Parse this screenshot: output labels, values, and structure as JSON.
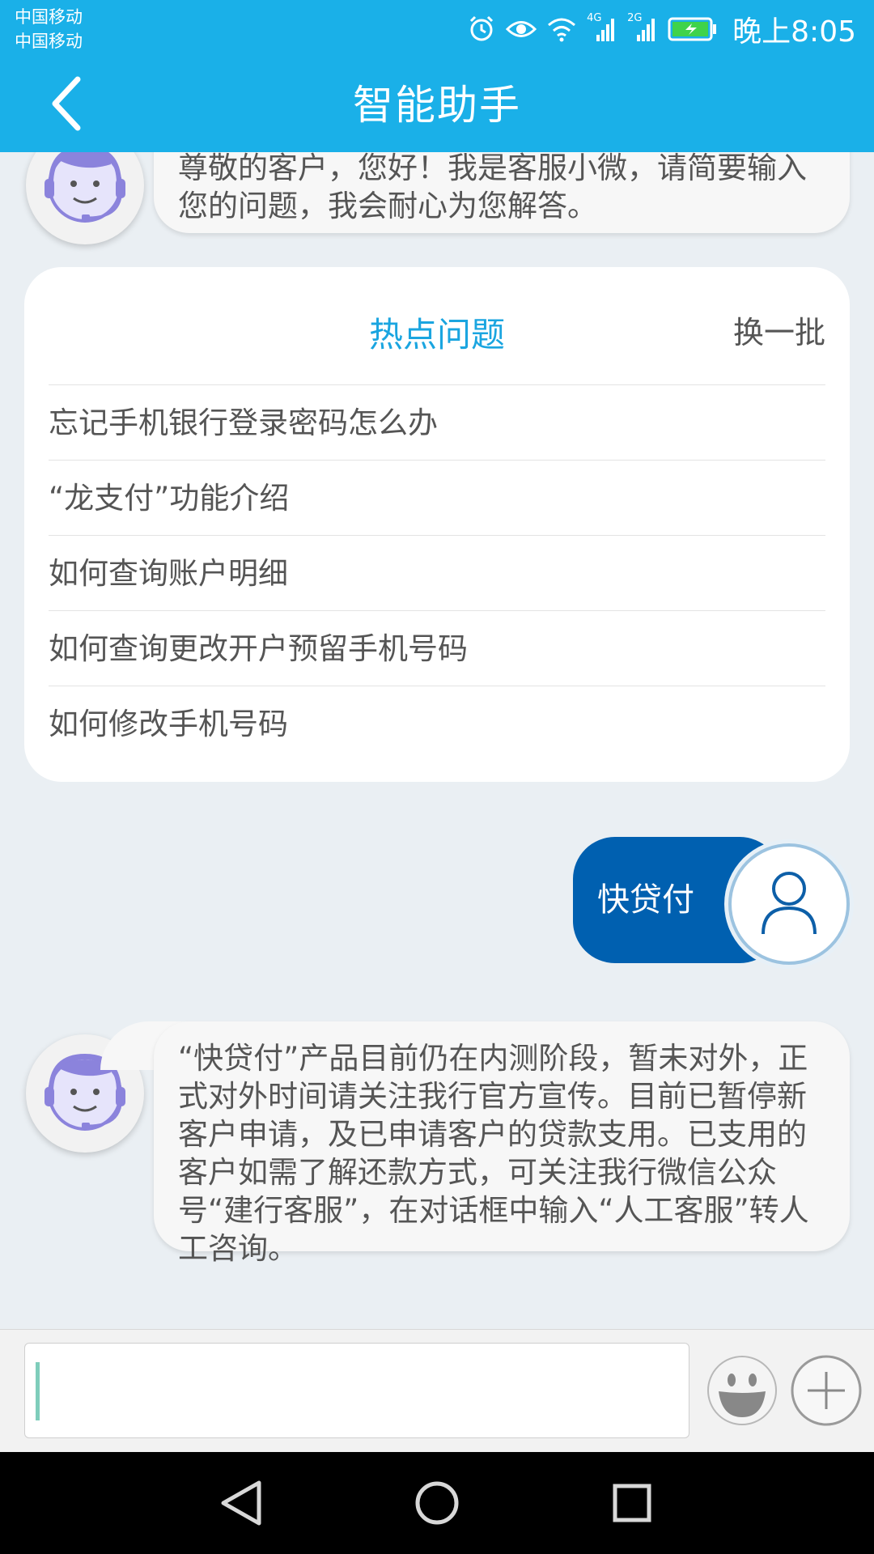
{
  "status_bar": {
    "carrier_1": "中国移动",
    "carrier_2": "中国移动",
    "network_1": "4G",
    "network_2": "2G",
    "time": "晚上8:05"
  },
  "header": {
    "title": "智能助手"
  },
  "chat": {
    "greeting": "尊敬的客户，您好！我是客服小微，请简要输入您的问题，我会耐心为您解答。",
    "hot_questions": {
      "title": "热点问题",
      "refresh_label": "换一批",
      "items": [
        "忘记手机银行登录密码怎么办",
        "“龙支付”功能介绍",
        "如何查询账户明细",
        "如何查询更改开户预留手机号码",
        "如何修改手机号码"
      ]
    },
    "user_message": "快贷付",
    "bot_reply": "“快贷付”产品目前仍在内测阶段，暂未对外，正式对外时间请关注我行官方宣传。目前已暂停新客户申请，及已申请客户的贷款支用。已支用的客户如需了解还款方式，可关注我行微信公众号“建行客服”，在对话框中输入“人工客服”转人工咨询。"
  },
  "input_bar": {
    "value": "",
    "placeholder": ""
  },
  "icons": {
    "back": "chevron-left-icon",
    "emoji": "smiley-icon",
    "plus": "plus-icon",
    "bot_avatar": "headset-robot-icon",
    "user_avatar": "person-icon",
    "alarm": "alarm-icon",
    "eye": "eye-icon",
    "wifi": "wifi-icon",
    "signal": "signal-icon",
    "battery": "battery-charging-icon",
    "sys_back": "triangle-back-icon",
    "sys_home": "circle-home-icon",
    "sys_recents": "square-recents-icon"
  },
  "colors": {
    "header": "#1ab0e8",
    "user_bubble": "#0060b0",
    "hot_title": "#1aa5e0"
  }
}
